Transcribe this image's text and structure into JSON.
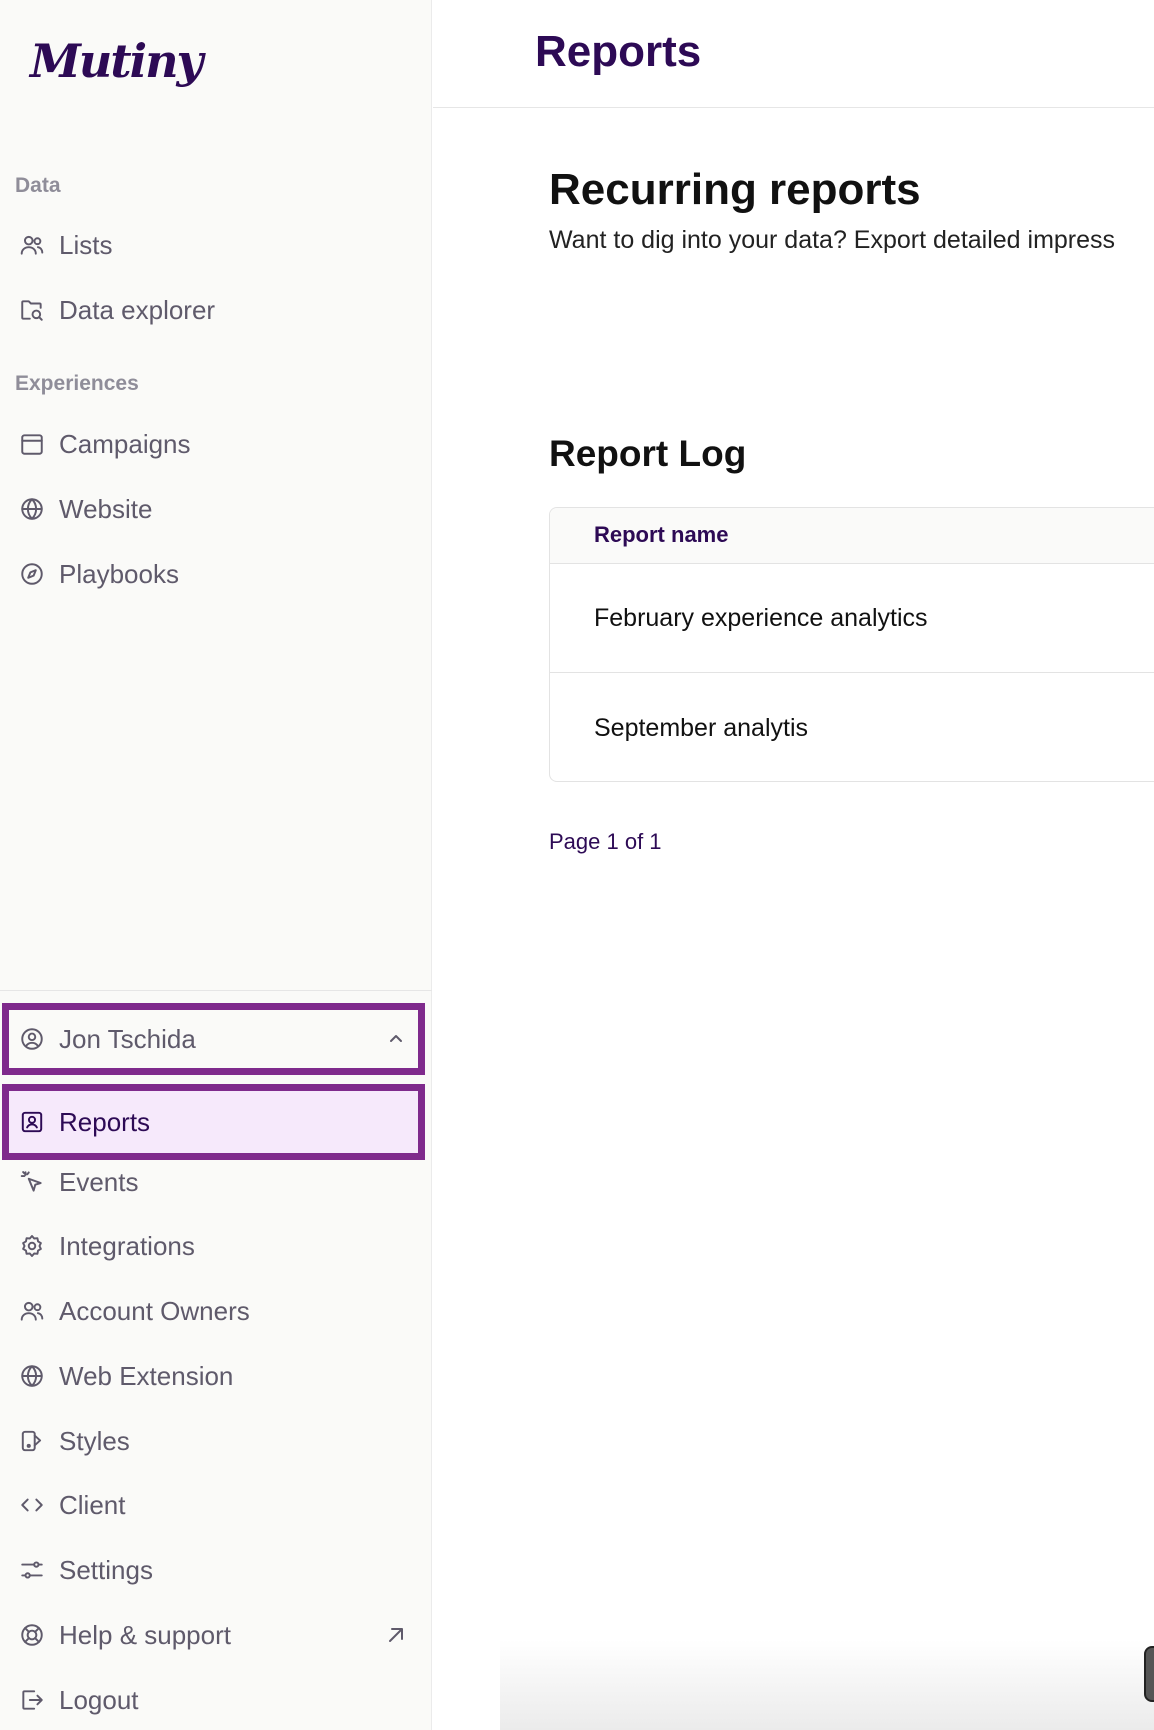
{
  "app": {
    "logo_text": "Mutiny"
  },
  "sidebar": {
    "sections": [
      {
        "label": "Data",
        "items": [
          {
            "label": "Lists",
            "icon": "users-icon"
          },
          {
            "label": "Data explorer",
            "icon": "folder-search-icon"
          }
        ]
      },
      {
        "label": "Experiences",
        "items": [
          {
            "label": "Campaigns",
            "icon": "calendar-icon"
          },
          {
            "label": "Website",
            "icon": "globe-icon"
          },
          {
            "label": "Playbooks",
            "icon": "compass-icon"
          }
        ]
      }
    ],
    "user": {
      "name": "Jon Tschida",
      "icon": "user-circle-icon",
      "expanded": true
    },
    "account_menu": [
      {
        "label": "Reports",
        "icon": "report-icon",
        "active": true
      },
      {
        "label": "Events",
        "icon": "cursor-click-icon"
      },
      {
        "label": "Integrations",
        "icon": "gear-icon"
      },
      {
        "label": "Account Owners",
        "icon": "users-icon"
      },
      {
        "label": "Web Extension",
        "icon": "globe-icon"
      },
      {
        "label": "Styles",
        "icon": "paint-icon"
      },
      {
        "label": "Client",
        "icon": "code-icon"
      },
      {
        "label": "Settings",
        "icon": "sliders-icon"
      },
      {
        "label": "Help & support",
        "icon": "lifebuoy-icon",
        "external": true
      },
      {
        "label": "Logout",
        "icon": "logout-icon"
      }
    ]
  },
  "header": {
    "title": "Reports"
  },
  "recurring": {
    "title": "Recurring reports",
    "description": "Want to dig into your data? Export detailed impress"
  },
  "report_log": {
    "title": "Report Log",
    "columns": [
      "Report name"
    ],
    "rows": [
      {
        "name": "February experience analytics"
      },
      {
        "name": "September analytis"
      }
    ],
    "pagination": "Page 1 of 1"
  },
  "colors": {
    "brand": "#2d0a55",
    "highlight": "#7f2a8c",
    "active_bg": "#f6e9fb"
  }
}
